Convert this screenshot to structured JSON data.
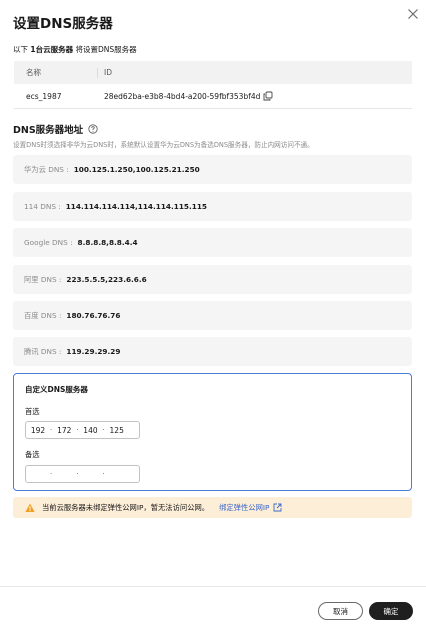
{
  "dialog": {
    "title": "设置DNS服务器",
    "intro_prefix": "以下",
    "intro_count": "1台云服务器",
    "intro_suffix": "将设置DNS服务器"
  },
  "table": {
    "col_name": "名称",
    "col_id": "ID",
    "rows": [
      {
        "name": "ecs_1987",
        "id": "28ed62ba-e3b8-4bd4-a200-59fbf353bf4d"
      }
    ]
  },
  "dns_section": {
    "title": "DNS服务器地址",
    "description": "设置DNS时须选择非华为云DNS时，系统默认设置华为云DNS为备选DNS服务器，防止内网访问不通。",
    "options": [
      {
        "label": "华为云 DNS :",
        "value": "100.125.1.250,100.125.21.250"
      },
      {
        "label": "114 DNS :",
        "value": "114.114.114.114,114.114.115.115"
      },
      {
        "label": "Google DNS :",
        "value": "8.8.8.8,8.8.4.4"
      },
      {
        "label": "阿里 DNS :",
        "value": "223.5.5.5,223.6.6.6"
      },
      {
        "label": "百度 DNS :",
        "value": "180.76.76.76"
      },
      {
        "label": "腾讯 DNS :",
        "value": "119.29.29.29"
      }
    ]
  },
  "custom": {
    "title": "自定义DNS服务器",
    "primary_label": "首选",
    "primary_octets": [
      "192",
      "172",
      "140",
      "125"
    ],
    "secondary_label": "备选",
    "secondary_octets": [
      "",
      "",
      "",
      ""
    ]
  },
  "warning": {
    "text": "当前云服务器未绑定弹性公网IP，暂无法访问公网。",
    "link": "绑定弹性公网IP"
  },
  "footer": {
    "cancel": "取消",
    "ok": "确定"
  },
  "colors": {
    "accent": "#4a7cd8",
    "link": "#3c68c8",
    "warning_bg": "#fdeed8",
    "warning_icon": "#f0a020",
    "primary_button": "#1f1f1f"
  }
}
